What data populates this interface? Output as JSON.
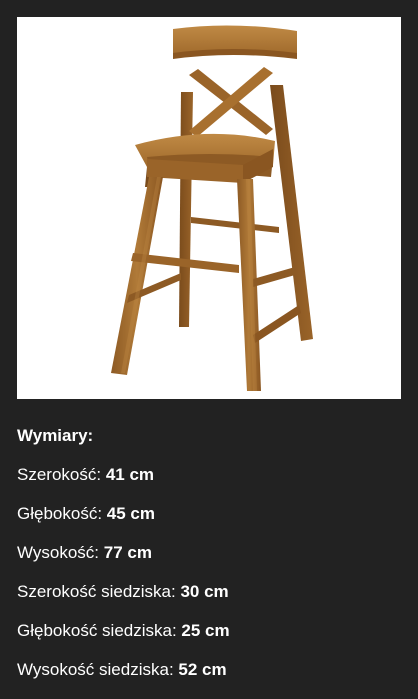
{
  "image": {
    "icon": "chair-photo",
    "background_color": "#ffffff",
    "wood_color": "#a8702f"
  },
  "specs": {
    "heading": "Wymiary:",
    "rows": [
      {
        "label": "Szerokość:",
        "value": "41 cm"
      },
      {
        "label": "Głębokość:",
        "value": "45 cm"
      },
      {
        "label": "Wysokość:",
        "value": "77 cm"
      },
      {
        "label": "Szerokość siedziska:",
        "value": "30 cm"
      },
      {
        "label": "Głębokość siedziska:",
        "value": "25 cm"
      },
      {
        "label": "Wysokość siedziska:",
        "value": "52 cm"
      }
    ]
  }
}
